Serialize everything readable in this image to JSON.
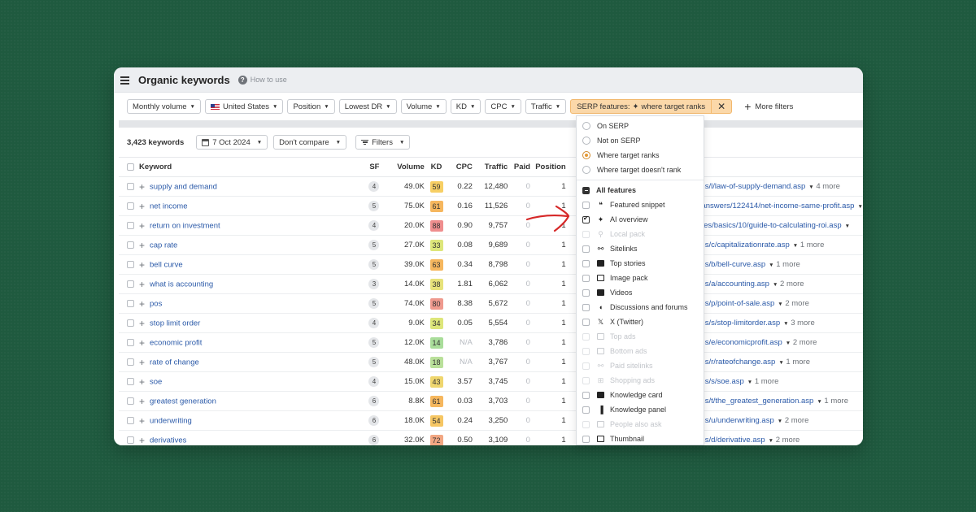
{
  "header": {
    "title": "Organic keywords",
    "help_label": "How to use",
    "help_icon": "?"
  },
  "filters": {
    "monthly_volume": "Monthly volume",
    "country": "United States",
    "position": "Position",
    "lowest_dr": "Lowest DR",
    "volume": "Volume",
    "kd": "KD",
    "cpc": "CPC",
    "traffic": "Traffic",
    "serp_label": "SERP features:",
    "serp_value": "where target ranks",
    "more_filters": "More filters"
  },
  "toolbar": {
    "count": "3,423 keywords",
    "date": "7 Oct 2024",
    "compare": "Don't compare",
    "filters": "Filters"
  },
  "columns": [
    "Keyword",
    "SF",
    "Volume",
    "KD",
    "CPC",
    "Traffic",
    "Paid",
    "Position"
  ],
  "rows": [
    {
      "keyword": "supply and demand",
      "sf": "4",
      "volume": "49.0K",
      "kd": "59",
      "kd_color": "#f7cf64",
      "cpc": "0.22",
      "traffic": "12,480",
      "paid": "0",
      "position": "1",
      "url": "erms/l/law-of-supply-demand.asp",
      "more": "4 more"
    },
    {
      "keyword": "net income",
      "sf": "5",
      "volume": "75.0K",
      "kd": "61",
      "kd_color": "#f6b75e",
      "cpc": "0.16",
      "traffic": "11,526",
      "paid": "0",
      "position": "1",
      "url": "sk/answers/122414/net-income-same-profit.asp",
      "more": ""
    },
    {
      "keyword": "return on investment",
      "sf": "4",
      "volume": "20.0K",
      "kd": "88",
      "kd_color": "#ef8e8e",
      "cpc": "0.90",
      "traffic": "9,757",
      "paid": "0",
      "position": "1",
      "url": "rticles/basics/10/guide-to-calculating-roi.asp",
      "more": ""
    },
    {
      "keyword": "cap rate",
      "sf": "5",
      "volume": "27.0K",
      "kd": "33",
      "kd_color": "#dde67a",
      "cpc": "0.08",
      "traffic": "9,689",
      "paid": "0",
      "position": "1",
      "url": "erms/c/capitalizationrate.asp",
      "more": "1 more"
    },
    {
      "keyword": "bell curve",
      "sf": "5",
      "volume": "39.0K",
      "kd": "63",
      "kd_color": "#f6b75e",
      "cpc": "0.34",
      "traffic": "8,798",
      "paid": "0",
      "position": "1",
      "url": "erms/b/bell-curve.asp",
      "more": "1 more"
    },
    {
      "keyword": "what is accounting",
      "sf": "3",
      "volume": "14.0K",
      "kd": "38",
      "kd_color": "#e7e27a",
      "cpc": "1.81",
      "traffic": "6,062",
      "paid": "0",
      "position": "1",
      "url": "erms/a/accounting.asp",
      "more": "2 more"
    },
    {
      "keyword": "pos",
      "sf": "5",
      "volume": "74.0K",
      "kd": "80",
      "kd_color": "#ef9a8e",
      "cpc": "8.38",
      "traffic": "5,672",
      "paid": "0",
      "position": "1",
      "url": "erms/p/point-of-sale.asp",
      "more": "2 more"
    },
    {
      "keyword": "stop limit order",
      "sf": "4",
      "volume": "9.0K",
      "kd": "34",
      "kd_color": "#dde67a",
      "cpc": "0.05",
      "traffic": "5,554",
      "paid": "0",
      "position": "1",
      "url": "erms/s/stop-limitorder.asp",
      "more": "3 more"
    },
    {
      "keyword": "economic profit",
      "sf": "5",
      "volume": "12.0K",
      "kd": "14",
      "kd_color": "#a9dd9a",
      "cpc": "N/A",
      "traffic": "3,786",
      "paid": "0",
      "position": "1",
      "url": "erms/e/economicprofit.asp",
      "more": "2 more"
    },
    {
      "keyword": "rate of change",
      "sf": "5",
      "volume": "48.0K",
      "kd": "18",
      "kd_color": "#b9e09a",
      "cpc": "N/A",
      "traffic": "3,767",
      "paid": "0",
      "position": "1",
      "url": "erms/r/rateofchange.asp",
      "more": "1 more"
    },
    {
      "keyword": "soe",
      "sf": "4",
      "volume": "15.0K",
      "kd": "43",
      "kd_color": "#efd66e",
      "cpc": "3.57",
      "traffic": "3,745",
      "paid": "0",
      "position": "1",
      "url": "erms/s/soe.asp",
      "more": "1 more"
    },
    {
      "keyword": "greatest generation",
      "sf": "6",
      "volume": "8.8K",
      "kd": "61",
      "kd_color": "#f6b75e",
      "cpc": "0.03",
      "traffic": "3,703",
      "paid": "0",
      "position": "1",
      "url": "erms/t/the_greatest_generation.asp",
      "more": "1 more"
    },
    {
      "keyword": "underwriting",
      "sf": "6",
      "volume": "18.0K",
      "kd": "54",
      "kd_color": "#f6c663",
      "cpc": "0.24",
      "traffic": "3,250",
      "paid": "0",
      "position": "1",
      "url": "erms/u/underwriting.asp",
      "more": "2 more"
    },
    {
      "keyword": "derivatives",
      "sf": "6",
      "volume": "32.0K",
      "kd": "72",
      "kd_color": "#f2a783",
      "cpc": "0.50",
      "traffic": "3,109",
      "paid": "0",
      "position": "1",
      "url": "erms/d/derivative.asp",
      "more": "2 more"
    }
  ],
  "dropdown": {
    "radios": [
      {
        "label": "On SERP",
        "on": false
      },
      {
        "label": "Not on SERP",
        "on": false
      },
      {
        "label": "Where target ranks",
        "on": true
      },
      {
        "label": "Where target doesn't rank",
        "on": false
      }
    ],
    "all_features": "All features",
    "features": [
      {
        "label": "Featured snippet",
        "icon": "quote-icon",
        "checked": false,
        "disabled": false
      },
      {
        "label": "AI overview",
        "icon": "sparkle-icon",
        "checked": true,
        "disabled": false
      },
      {
        "label": "Local pack",
        "icon": "pin-icon",
        "checked": false,
        "disabled": true
      },
      {
        "label": "Sitelinks",
        "icon": "link-icon",
        "checked": false,
        "disabled": false
      },
      {
        "label": "Top stories",
        "icon": "news-icon",
        "checked": false,
        "disabled": false
      },
      {
        "label": "Image pack",
        "icon": "image-icon",
        "checked": false,
        "disabled": false
      },
      {
        "label": "Videos",
        "icon": "video-icon",
        "checked": false,
        "disabled": false
      },
      {
        "label": "Discussions and forums",
        "icon": "chat-icon",
        "checked": false,
        "disabled": false
      },
      {
        "label": "X (Twitter)",
        "icon": "x-icon",
        "checked": false,
        "disabled": false
      },
      {
        "label": "Top ads",
        "icon": "ad-icon",
        "checked": false,
        "disabled": true
      },
      {
        "label": "Bottom ads",
        "icon": "ad-icon",
        "checked": false,
        "disabled": true
      },
      {
        "label": "Paid sitelinks",
        "icon": "link-icon",
        "checked": false,
        "disabled": true
      },
      {
        "label": "Shopping ads",
        "icon": "cart-icon",
        "checked": false,
        "disabled": true
      },
      {
        "label": "Knowledge card",
        "icon": "card-icon",
        "checked": false,
        "disabled": false
      },
      {
        "label": "Knowledge panel",
        "icon": "panel-icon",
        "checked": false,
        "disabled": false
      },
      {
        "label": "People also ask",
        "icon": "question-icon",
        "checked": false,
        "disabled": true
      },
      {
        "label": "Thumbnail",
        "icon": "thumbnail-icon",
        "checked": false,
        "disabled": false
      }
    ]
  },
  "colors": {
    "background": "#1f5a3f",
    "serp_highlight": "#fbd8a9",
    "link": "#2a59a8",
    "annotation_arrow": "#d62828"
  }
}
